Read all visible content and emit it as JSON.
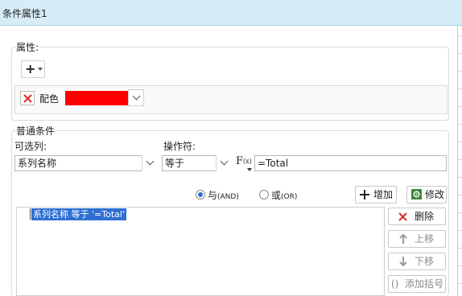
{
  "window": {
    "title": "条件属性1"
  },
  "properties": {
    "group_label": "属性:",
    "add_button": "+",
    "color_row": {
      "label": "配色",
      "color": "#ff0000"
    }
  },
  "conditions": {
    "group_label": "普通条件",
    "column_label": "可选列:",
    "column_value": "系列名称",
    "operator_label": "操作符:",
    "operator_value": "等于",
    "fx_label": "F",
    "fx_sub": "(x)",
    "value": "=Total",
    "and_label": "与",
    "and_sub": "(AND)",
    "or_label": "或",
    "or_sub": "(OR)",
    "logic_selected": "and",
    "add_label": "增加",
    "edit_label": "修改",
    "list_items": [
      "系列名称 等于 '=Total'"
    ],
    "delete_label": "删除",
    "move_up_label": "上移",
    "move_down_label": "下移",
    "add_bracket_label": "添加括号"
  },
  "colors": {
    "title_bar": "#d6ecf7",
    "selection": "#2f6fd3",
    "delete_red": "#d92a2a"
  }
}
